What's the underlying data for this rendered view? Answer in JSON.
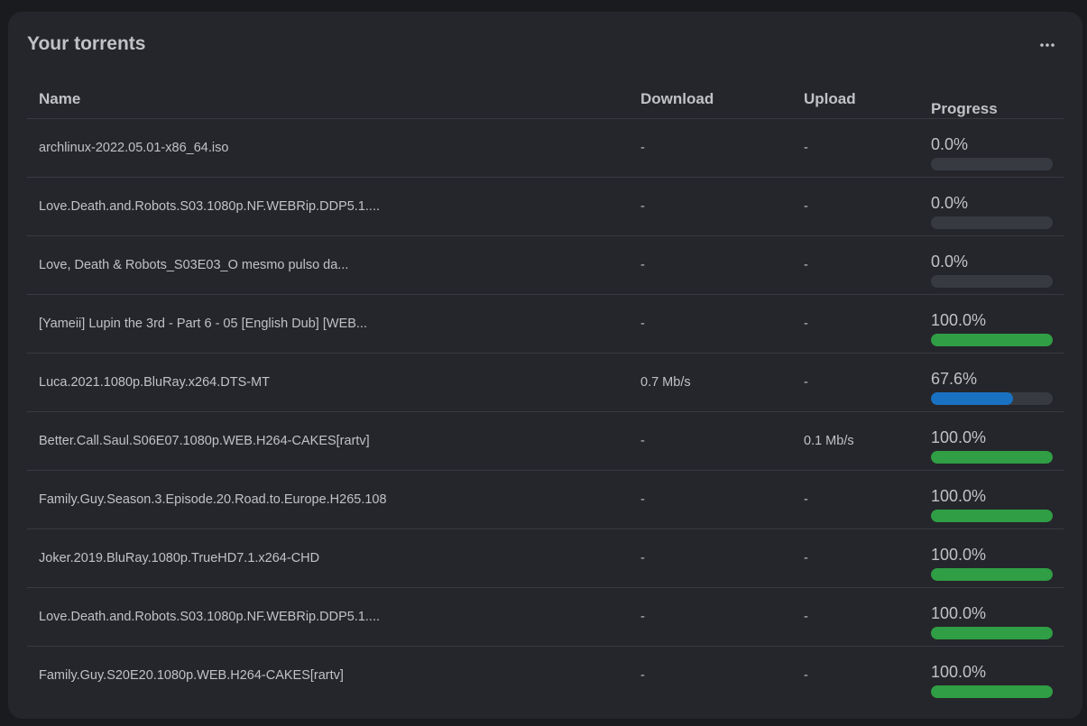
{
  "panel": {
    "title": "Your torrents",
    "menu_icon": "ellipsis-icon"
  },
  "table": {
    "headers": {
      "name": "Name",
      "download": "Download",
      "upload": "Upload",
      "progress": "Progress"
    },
    "rows": [
      {
        "name": "archlinux-2022.05.01-x86_64.iso",
        "download": "-",
        "upload": "-",
        "progress": 0.0,
        "progress_label": "0.0%",
        "color": "#373a40"
      },
      {
        "name": "Love.Death.and.Robots.S03.1080p.NF.WEBRip.DDP5.1....",
        "download": "-",
        "upload": "-",
        "progress": 0.0,
        "progress_label": "0.0%",
        "color": "#373a40"
      },
      {
        "name": "Love, Death & Robots_S03E03_O mesmo pulso da...",
        "download": "-",
        "upload": "-",
        "progress": 0.0,
        "progress_label": "0.0%",
        "color": "#373a40"
      },
      {
        "name": "[Yameii] Lupin the 3rd - Part 6 - 05 [English Dub] [WEB...",
        "download": "-",
        "upload": "-",
        "progress": 100.0,
        "progress_label": "100.0%",
        "color": "#2f9e44"
      },
      {
        "name": "Luca.2021.1080p.BluRay.x264.DTS-MT",
        "download": "0.7 Mb/s",
        "upload": "-",
        "progress": 67.6,
        "progress_label": "67.6%",
        "color": "#1971c2"
      },
      {
        "name": "Better.Call.Saul.S06E07.1080p.WEB.H264-CAKES[rartv]",
        "download": "-",
        "upload": "0.1 Mb/s",
        "progress": 100.0,
        "progress_label": "100.0%",
        "color": "#2f9e44"
      },
      {
        "name": "Family.Guy.Season.3.Episode.20.Road.to.Europe.H265.108",
        "download": "-",
        "upload": "-",
        "progress": 100.0,
        "progress_label": "100.0%",
        "color": "#2f9e44"
      },
      {
        "name": "Joker.2019.BluRay.1080p.TrueHD7.1.x264-CHD",
        "download": "-",
        "upload": "-",
        "progress": 100.0,
        "progress_label": "100.0%",
        "color": "#2f9e44"
      },
      {
        "name": "Love.Death.and.Robots.S03.1080p.NF.WEBRip.DDP5.1....",
        "download": "-",
        "upload": "-",
        "progress": 100.0,
        "progress_label": "100.0%",
        "color": "#2f9e44"
      },
      {
        "name": "Family.Guy.S20E20.1080p.WEB.H264-CAKES[rartv]",
        "download": "-",
        "upload": "-",
        "progress": 100.0,
        "progress_label": "100.0%",
        "color": "#2f9e44"
      }
    ]
  }
}
